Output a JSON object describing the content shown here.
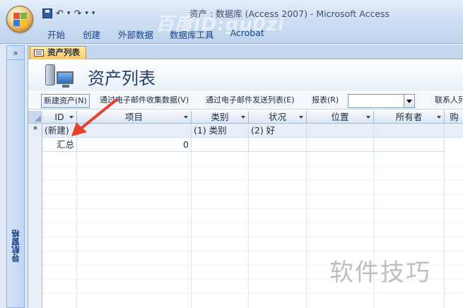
{
  "window": {
    "title": "资产 : 数据库 (Access 2007) - Microsoft Access",
    "watermark_top": "百度ID:gu0zi"
  },
  "ribbon": {
    "tabs": [
      "开始",
      "创建",
      "外部数据",
      "数据库工具",
      "Acrobat"
    ]
  },
  "nav_pane": {
    "toggle": "»",
    "label": "导航窗格"
  },
  "document": {
    "tab_label": "资产列表",
    "header_title": "资产列表"
  },
  "toolbar": {
    "new_asset": "新建资产(N)",
    "collect_email": "通过电子邮件收集数据(V)",
    "send_email": "通过电子邮件发送列表(E)",
    "reports": "报表(R)",
    "report_select_value": "",
    "contacts": "联系人列"
  },
  "datasheet": {
    "columns": [
      "ID",
      "项目",
      "类别",
      "状况",
      "位置",
      "所有者",
      "购"
    ],
    "new_row": {
      "selector": "*",
      "id": "(新建)",
      "item": "",
      "category": "(1) 类别",
      "condition": "(2) 好"
    },
    "total_row": {
      "label": "汇总",
      "item": "0"
    }
  },
  "watermark_bottom": "软件技巧",
  "colors": {
    "accent_tab": "#ffc95f",
    "arrow": "#e8402a",
    "ribbon_text": "#15428b"
  }
}
